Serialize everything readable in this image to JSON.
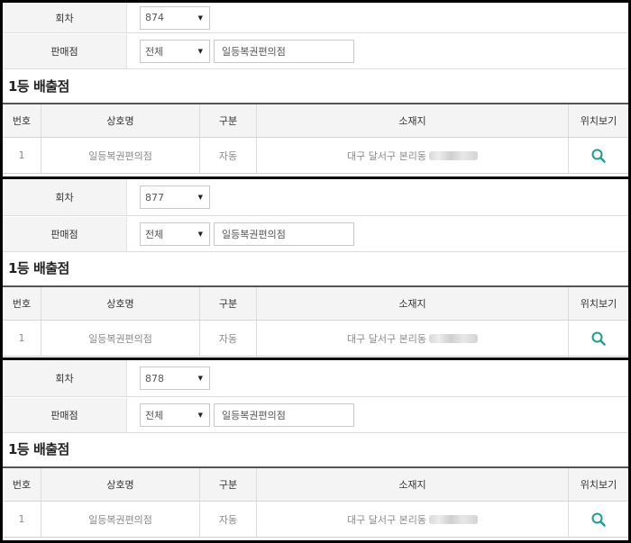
{
  "labels": {
    "round": "회차",
    "store": "판매점"
  },
  "sections": [
    {
      "round": "874",
      "store_select": "전체",
      "store_name": "일등복권편의점",
      "heading": "1등 배출점",
      "columns": [
        "번호",
        "상호명",
        "구분",
        "소재지",
        "위치보기"
      ],
      "row": {
        "no": "1",
        "name": "일등복권편의점",
        "type": "자동",
        "address": "대구 달서구 본리동"
      }
    },
    {
      "round": "877",
      "store_select": "전체",
      "store_name": "일등복권편의점",
      "heading": "1등 배출점",
      "columns": [
        "번호",
        "상호명",
        "구분",
        "소재지",
        "위치보기"
      ],
      "row": {
        "no": "1",
        "name": "일등복권편의점",
        "type": "자동",
        "address": "대구 달서구 본리동"
      }
    },
    {
      "round": "878",
      "store_select": "전체",
      "store_name": "일등복권편의점",
      "heading": "1등 배출점",
      "columns": [
        "번호",
        "상호명",
        "구분",
        "소재지",
        "위치보기"
      ],
      "row": {
        "no": "1",
        "name": "일등복권편의점",
        "type": "자동",
        "address": "대구 달서구 본리동"
      }
    }
  ],
  "colors": {
    "accent": "#1a9c94",
    "header_bg": "#f4f4f4"
  },
  "icons": {
    "location": "search-icon",
    "dropdown": "caret-down-icon"
  }
}
